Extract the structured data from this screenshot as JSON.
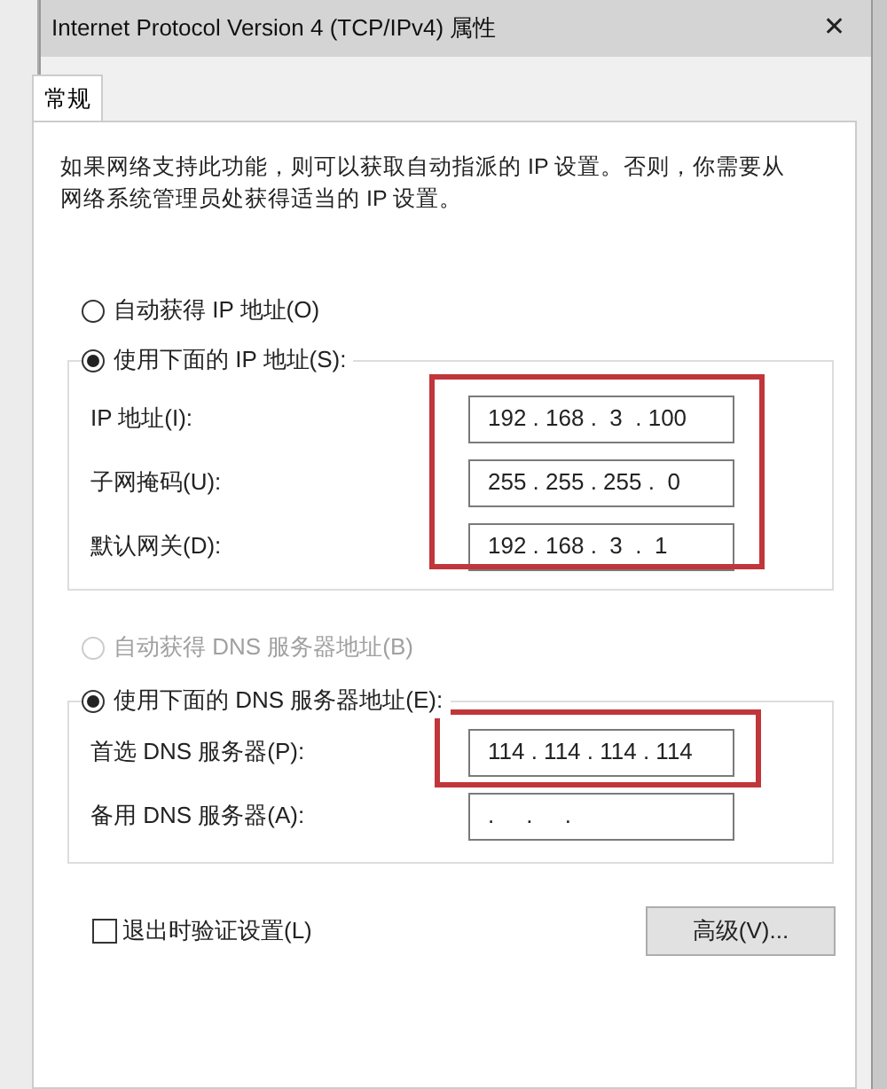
{
  "window": {
    "title": "Internet Protocol Version 4 (TCP/IPv4) 属性",
    "close": "✕"
  },
  "tabs": [
    {
      "label": "常规",
      "selected": true
    }
  ],
  "description": "如果网络支持此功能，则可以获取自动指派的 IP 设置。否则，你需要从网络系统管理员处获得适当的 IP 设置。",
  "ip_auto": {
    "label": "自动获得 IP 地址(O)",
    "selected": false,
    "disabled": false
  },
  "ip_manual": {
    "label": "使用下面的 IP 地址(S):",
    "selected": true,
    "disabled": false,
    "highlighted": true,
    "fields": [
      {
        "label": "IP 地址(I):",
        "value": "192 . 168 .  3  . 100"
      },
      {
        "label": "子网掩码(U):",
        "value": "255 . 255 . 255 .  0"
      },
      {
        "label": "默认网关(D):",
        "value": "192 . 168 .  3  .  1"
      }
    ]
  },
  "dns_auto": {
    "label": "自动获得 DNS 服务器地址(B)",
    "selected": false,
    "disabled": true
  },
  "dns_manual": {
    "label": "使用下面的 DNS 服务器地址(E):",
    "selected": true,
    "disabled": false,
    "fields": [
      {
        "label": "首选 DNS 服务器(P):",
        "value": "114 . 114 . 114 . 114",
        "highlighted": true
      },
      {
        "label": "备用 DNS 服务器(A):",
        "value": ".     .     .",
        "highlighted": false
      }
    ]
  },
  "validate": {
    "label": "退出时验证设置(L)",
    "checked": false
  },
  "advanced_button": "高级(V)..."
}
